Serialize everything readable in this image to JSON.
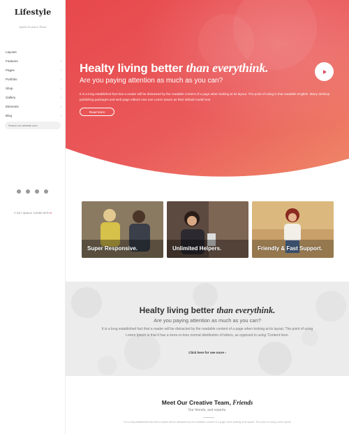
{
  "sidebar": {
    "logo": "Lifestyle",
    "tagline": "Qualia Exclusive Theme",
    "nav": [
      {
        "label": "Layouts",
        "has_submenu": false
      },
      {
        "label": "Features",
        "has_submenu": true
      },
      {
        "label": "Pages",
        "has_submenu": true
      },
      {
        "label": "Portfolio",
        "has_submenu": true
      },
      {
        "label": "Shop",
        "has_submenu": true
      },
      {
        "label": "Gallery",
        "has_submenu": true
      },
      {
        "label": "Elements",
        "has_submenu": true
      },
      {
        "label": "Blog",
        "has_submenu": true
      }
    ],
    "search_placeholder": "Search on website.com",
    "socials": [
      "twitter-icon",
      "dribbble-icon",
      "instagram-icon",
      "skype-icon"
    ],
    "copyright": "© 2017 QUALIA. CODED WITH"
  },
  "hero": {
    "title_plain": "Healty living better",
    "title_italic": "than everythink.",
    "subtitle": "Are you paying attention as much as you can?",
    "text": "It is a long established fact that a reader will be distracted by the readable content of a page when looking at its layout. The point of using is that readable English. Many desktop publishing packages and web page editors now use Lorem Ipsum as their default model text",
    "button_label": "Read More",
    "gradient_colors": [
      "#e7484c",
      "#f06a5c",
      "#ee8a69"
    ]
  },
  "cards": [
    {
      "label": "Super Responsive."
    },
    {
      "label": "Unlimited Helpers."
    },
    {
      "label": "Friendly & Fast Support."
    }
  ],
  "promo": {
    "title_plain": "Healty living better",
    "title_italic": "than everythink.",
    "subtitle": "Are you paying attention as much as you can?",
    "text": "It is a long established fact that a reader will be distracted by the readable content of a page when looking at its layout. The point of using Lorem Ipsum is that it has a more-or-less normal distribution of letters, as opposed to using 'Content here.",
    "link_label": "Click here for see more ›"
  },
  "team": {
    "title_plain": "Meet Our Creative Team,",
    "title_italic": "Friends",
    "subtitle": "Our friends, and experts.",
    "text": "It is a long established fact that a reader will be distracted by the readable content of a page when looking at its layout. The point of using Lorem Ipsum"
  }
}
